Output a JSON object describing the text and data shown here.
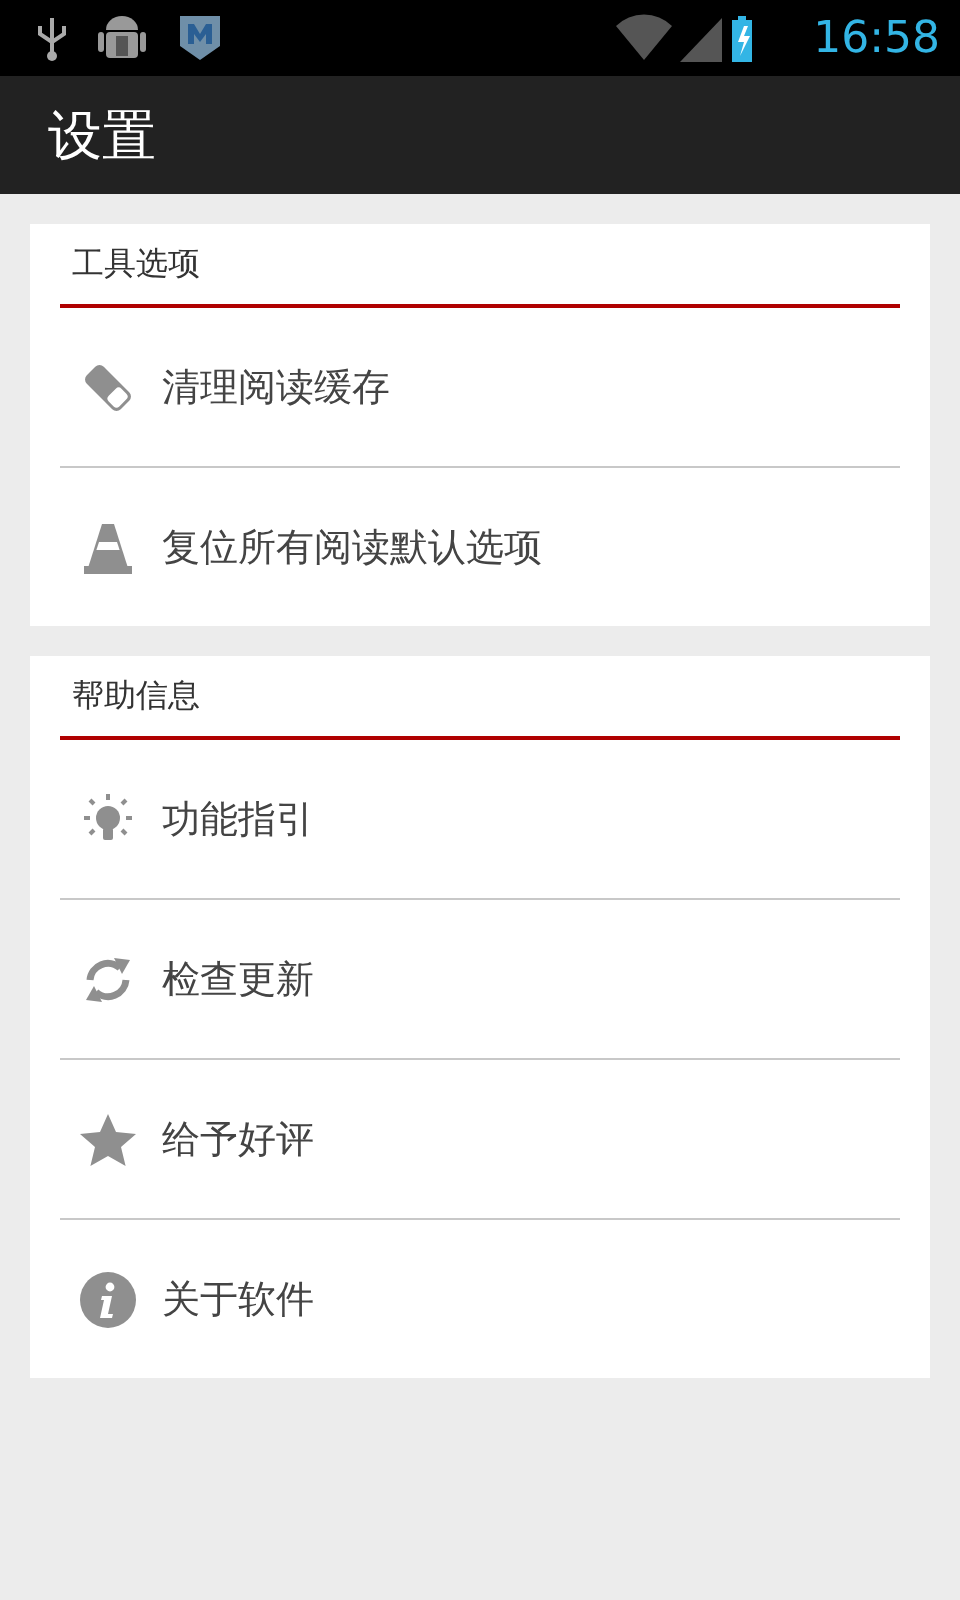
{
  "status_bar": {
    "time": "16:58"
  },
  "app_bar": {
    "title": "设置"
  },
  "sections": [
    {
      "title": "工具选项",
      "items": [
        {
          "kind": "eraser",
          "label": "清理阅读缓存"
        },
        {
          "kind": "cone",
          "label": "复位所有阅读默认选项"
        }
      ]
    },
    {
      "title": "帮助信息",
      "items": [
        {
          "kind": "bulb",
          "label": "功能指引"
        },
        {
          "kind": "refresh",
          "label": "检查更新"
        },
        {
          "kind": "star",
          "label": "给予好评"
        },
        {
          "kind": "info",
          "label": "关于软件"
        }
      ]
    }
  ]
}
